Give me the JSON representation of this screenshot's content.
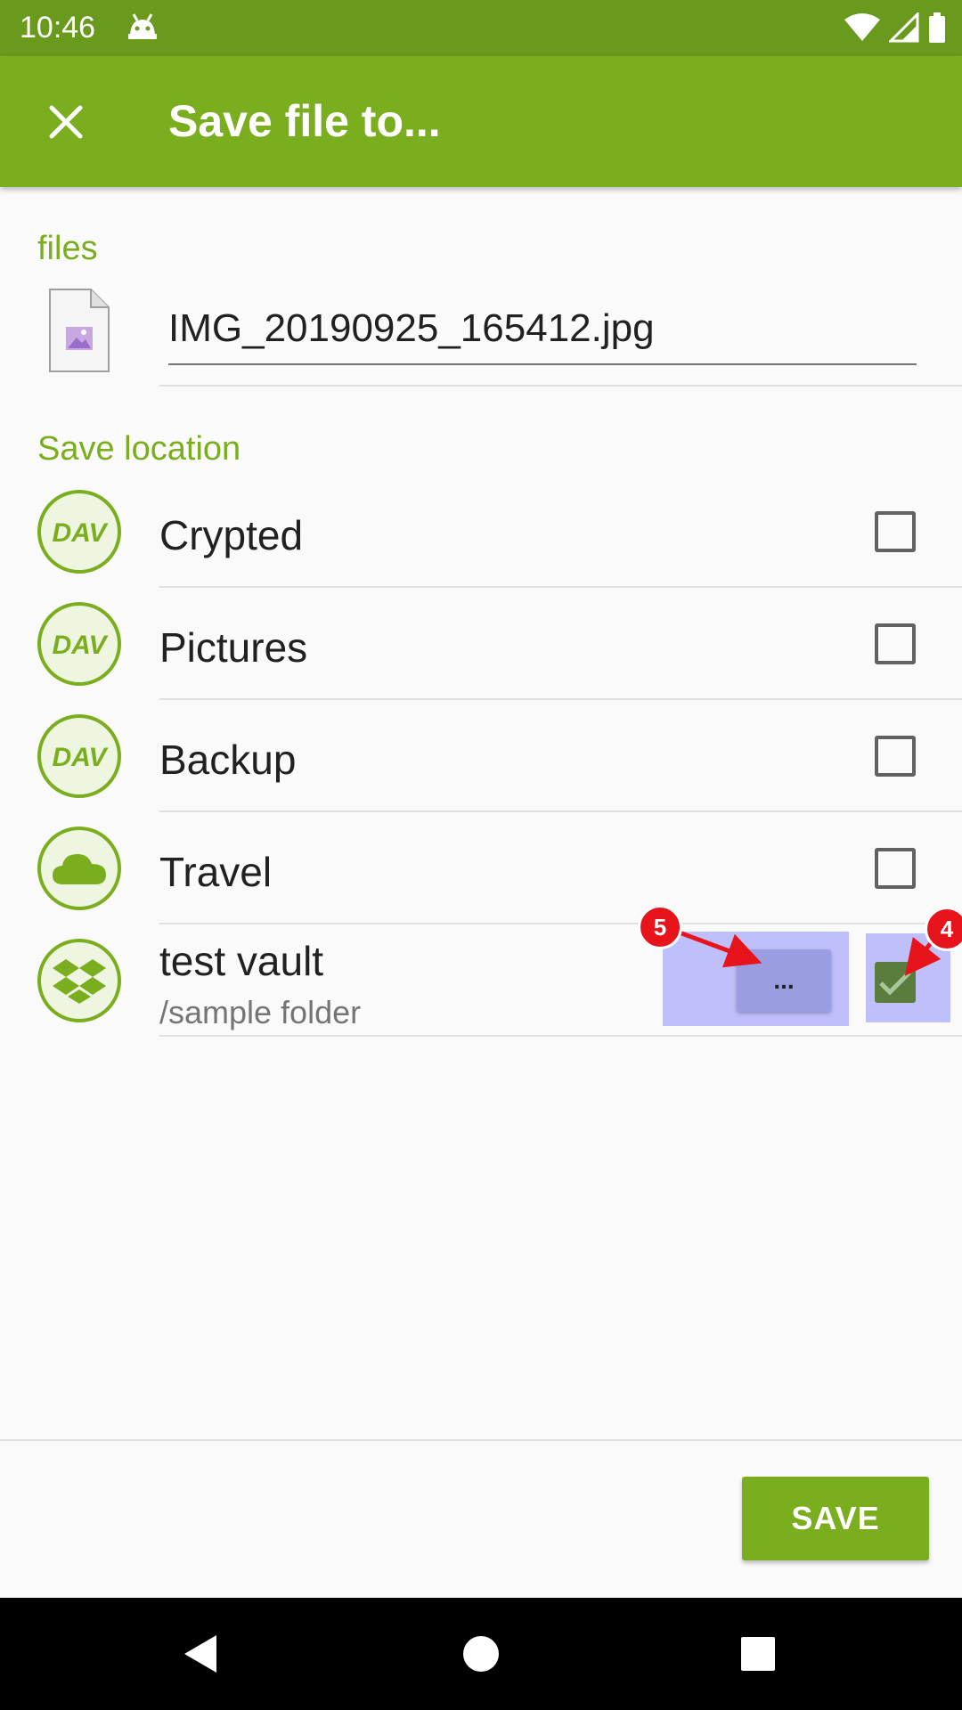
{
  "status_bar": {
    "time": "10:46",
    "icons": [
      "android-debug-icon",
      "wifi-icon",
      "signal-icon",
      "battery-icon"
    ]
  },
  "app_bar": {
    "title": "Save file to...",
    "close_icon": "close-icon"
  },
  "files_section": {
    "header": "files",
    "file_icon": "image-file-icon",
    "filename": "IMG_20190925_165412.jpg"
  },
  "save_location": {
    "header": "Save location",
    "items": [
      {
        "label": "Crypted",
        "icon": "dav-icon",
        "checked": false
      },
      {
        "label": "Pictures",
        "icon": "dav-icon",
        "checked": false
      },
      {
        "label": "Backup",
        "icon": "dav-icon",
        "checked": false
      },
      {
        "label": "Travel",
        "icon": "cloud-icon",
        "checked": false
      },
      {
        "label": "test vault",
        "subtitle": "/sample folder",
        "icon": "dropbox-icon",
        "checked": true,
        "more_label": "..."
      }
    ]
  },
  "annotations": {
    "badge_5": "5",
    "badge_4": "4",
    "color": "#e8141b",
    "highlight_color": "#7878ff"
  },
  "footer": {
    "save_label": "SAVE"
  },
  "colors": {
    "primary": "#7aae1e",
    "status_bar": "#6a9a1d"
  }
}
